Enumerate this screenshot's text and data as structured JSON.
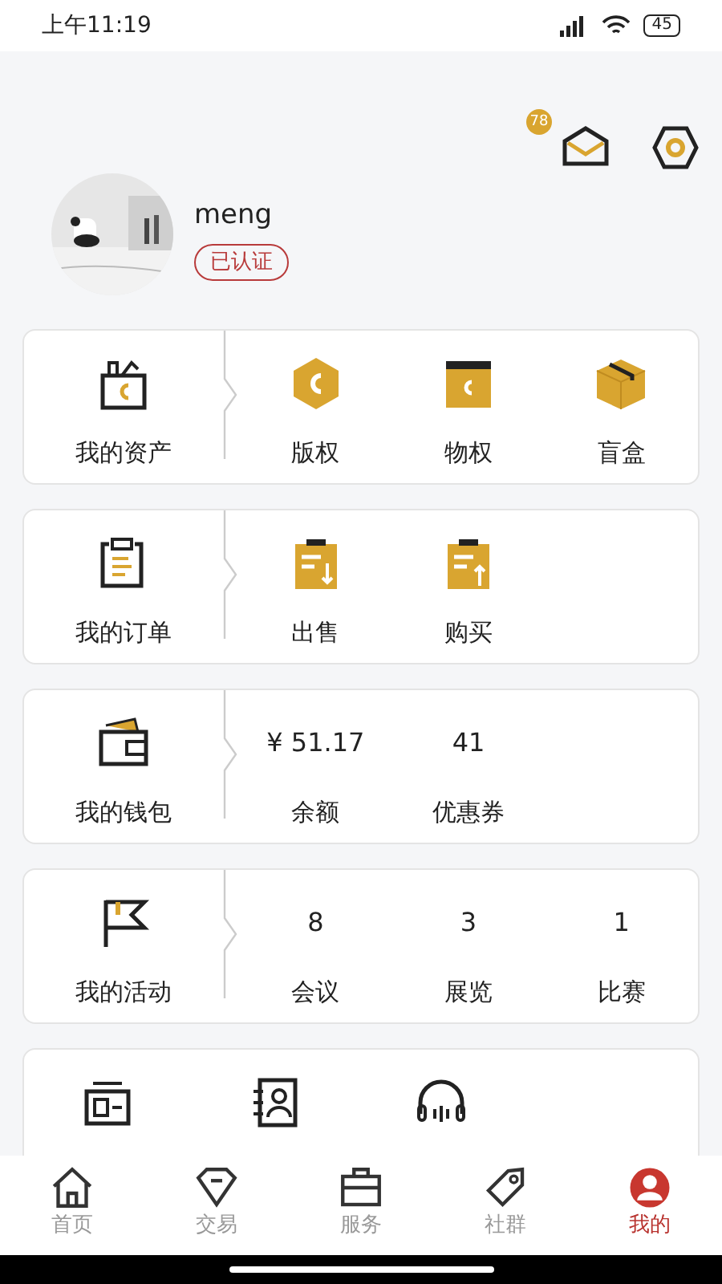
{
  "status_bar": {
    "time": "上午11:19",
    "battery": "45"
  },
  "header": {
    "message_count": "78"
  },
  "profile": {
    "name": "meng",
    "badge": "已认证"
  },
  "sections": [
    {
      "title": "我的资产",
      "items": [
        {
          "label": "版权"
        },
        {
          "label": "物权"
        },
        {
          "label": "盲盒"
        }
      ]
    },
    {
      "title": "我的订单",
      "items": [
        {
          "label": "出售"
        },
        {
          "label": "购买"
        }
      ]
    },
    {
      "title": "我的钱包",
      "items": [
        {
          "value": "¥ 51.17",
          "label": "余额"
        },
        {
          "value": "41",
          "label": "优惠券"
        }
      ]
    },
    {
      "title": "我的活动",
      "items": [
        {
          "value": "8",
          "label": "会议"
        },
        {
          "value": "3",
          "label": "展览"
        },
        {
          "value": "1",
          "label": "比赛"
        }
      ]
    }
  ],
  "tools": [
    {
      "kind": "id_card"
    },
    {
      "kind": "contacts"
    },
    {
      "kind": "headphones"
    }
  ],
  "tabs": [
    {
      "label": "首页",
      "selected": false
    },
    {
      "label": "交易",
      "selected": false
    },
    {
      "label": "服务",
      "selected": false
    },
    {
      "label": "社群",
      "selected": false
    },
    {
      "label": "我的",
      "selected": true
    }
  ]
}
